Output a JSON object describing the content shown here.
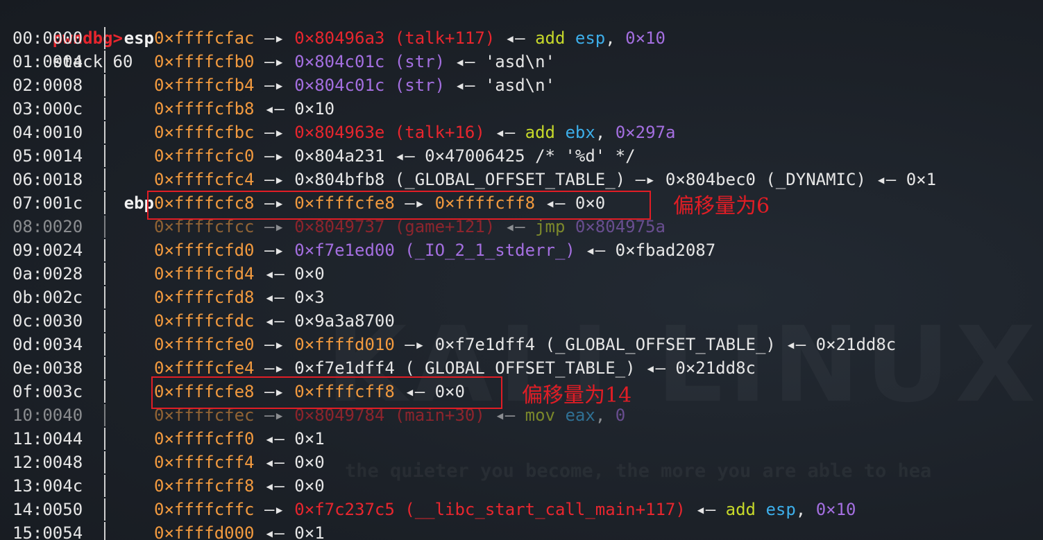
{
  "terminal": {
    "prompt": "pwndbg>",
    "command": "stack 60",
    "watermark": "KALI LINUX",
    "tagline": "the quieter you become, the more you are able to hea",
    "colors": {
      "prompt": "#e8262e",
      "stack_address": "#f29a3f",
      "code_pointer": "#e8262e",
      "data_pointer": "#a46fe0",
      "instruction": "#c6d82a",
      "register": "#3daee9",
      "annotation": "#e11d25"
    }
  },
  "stack": [
    {
      "offset": "00:0000",
      "reg": "esp",
      "parts": [
        {
          "t": "0×ffffcfac",
          "c": "addr"
        },
        {
          "t": " —▸ ",
          "c": "plain"
        },
        {
          "t": "0×80496a3 (talk+117)",
          "c": "code"
        },
        {
          "t": " ◂— ",
          "c": "plain"
        },
        {
          "t": "add",
          "c": "mnem"
        },
        {
          "t": " ",
          "c": "plain"
        },
        {
          "t": "esp",
          "c": "regname"
        },
        {
          "t": ", ",
          "c": "plain"
        },
        {
          "t": "0×10",
          "c": "imm"
        }
      ]
    },
    {
      "offset": "01:0004",
      "reg": "",
      "parts": [
        {
          "t": "0×ffffcfb0",
          "c": "addr"
        },
        {
          "t": " —▸ ",
          "c": "plain"
        },
        {
          "t": "0×804c01c (str)",
          "c": "data"
        },
        {
          "t": " ◂— ",
          "c": "plain"
        },
        {
          "t": "'asd\\n'",
          "c": "str"
        }
      ]
    },
    {
      "offset": "02:0008",
      "reg": "",
      "parts": [
        {
          "t": "0×ffffcfb4",
          "c": "addr"
        },
        {
          "t": " —▸ ",
          "c": "plain"
        },
        {
          "t": "0×804c01c (str)",
          "c": "data"
        },
        {
          "t": " ◂— ",
          "c": "plain"
        },
        {
          "t": "'asd\\n'",
          "c": "str"
        }
      ]
    },
    {
      "offset": "03:000c",
      "reg": "",
      "parts": [
        {
          "t": "0×ffffcfb8",
          "c": "addr"
        },
        {
          "t": " ◂— 0×10",
          "c": "plain"
        }
      ]
    },
    {
      "offset": "04:0010",
      "reg": "",
      "parts": [
        {
          "t": "0×ffffcfbc",
          "c": "addr"
        },
        {
          "t": " —▸ ",
          "c": "plain"
        },
        {
          "t": "0×804963e (talk+16)",
          "c": "code"
        },
        {
          "t": " ◂— ",
          "c": "plain"
        },
        {
          "t": "add",
          "c": "mnem"
        },
        {
          "t": " ",
          "c": "plain"
        },
        {
          "t": "ebx",
          "c": "regname"
        },
        {
          "t": ", ",
          "c": "plain"
        },
        {
          "t": "0×297a",
          "c": "imm"
        }
      ]
    },
    {
      "offset": "05:0014",
      "reg": "",
      "parts": [
        {
          "t": "0×ffffcfc0",
          "c": "addr"
        },
        {
          "t": " —▸ 0×804a231 ◂— 0×47006425 /* '%d' */",
          "c": "plain"
        }
      ]
    },
    {
      "offset": "06:0018",
      "reg": "",
      "parts": [
        {
          "t": "0×ffffcfc4",
          "c": "addr"
        },
        {
          "t": " —▸ 0×804bfb8 (_GLOBAL_OFFSET_TABLE_) —▸ 0×804bec0 (_DYNAMIC) ◂— 0×1",
          "c": "plain"
        }
      ]
    },
    {
      "offset": "07:001c",
      "reg": "ebp",
      "parts": [
        {
          "t": "0×ffffcfc8",
          "c": "addr"
        },
        {
          "t": " —▸ ",
          "c": "plain"
        },
        {
          "t": "0×ffffcfe8",
          "c": "addr"
        },
        {
          "t": " —▸ ",
          "c": "plain"
        },
        {
          "t": "0×ffffcff8",
          "c": "addr"
        },
        {
          "t": " ◂— 0×0",
          "c": "plain"
        }
      ]
    },
    {
      "offset": "08:0020",
      "reg": "",
      "parts": [
        {
          "t": "0×ffffcfcc",
          "c": "addr"
        },
        {
          "t": " —▸ ",
          "c": "plain"
        },
        {
          "t": "0×8049737 (game+121)",
          "c": "code"
        },
        {
          "t": " ◂— ",
          "c": "plain"
        },
        {
          "t": "jmp",
          "c": "mnem"
        },
        {
          "t": " ",
          "c": "plain"
        },
        {
          "t": "0×804975a",
          "c": "imm"
        }
      ]
    },
    {
      "offset": "09:0024",
      "reg": "",
      "parts": [
        {
          "t": "0×ffffcfd0",
          "c": "addr"
        },
        {
          "t": " —▸ ",
          "c": "plain"
        },
        {
          "t": "0×f7e1ed00 (_IO_2_1_stderr_)",
          "c": "data"
        },
        {
          "t": " ◂— 0×fbad2087",
          "c": "plain"
        }
      ]
    },
    {
      "offset": "0a:0028",
      "reg": "",
      "parts": [
        {
          "t": "0×ffffcfd4",
          "c": "addr"
        },
        {
          "t": " ◂— 0×0",
          "c": "plain"
        }
      ]
    },
    {
      "offset": "0b:002c",
      "reg": "",
      "parts": [
        {
          "t": "0×ffffcfd8",
          "c": "addr"
        },
        {
          "t": " ◂— 0×3",
          "c": "plain"
        }
      ]
    },
    {
      "offset": "0c:0030",
      "reg": "",
      "parts": [
        {
          "t": "0×ffffcfdc",
          "c": "addr"
        },
        {
          "t": " ◂— 0×9a3a8700",
          "c": "plain"
        }
      ]
    },
    {
      "offset": "0d:0034",
      "reg": "",
      "parts": [
        {
          "t": "0×ffffcfe0",
          "c": "addr"
        },
        {
          "t": " —▸ ",
          "c": "plain"
        },
        {
          "t": "0×ffffd010",
          "c": "addr"
        },
        {
          "t": " —▸ 0×f7e1dff4 (_GLOBAL_OFFSET_TABLE_) ◂— 0×21dd8c",
          "c": "plain"
        }
      ]
    },
    {
      "offset": "0e:0038",
      "reg": "",
      "parts": [
        {
          "t": "0×ffffcfe4",
          "c": "addr"
        },
        {
          "t": " —▸ 0×f7e1dff4 (_GLOBAL_OFFSET_TABLE_) ◂— 0×21dd8c",
          "c": "plain"
        }
      ]
    },
    {
      "offset": "0f:003c",
      "reg": "",
      "parts": [
        {
          "t": "0×ffffcfe8",
          "c": "addr"
        },
        {
          "t": " —▸ ",
          "c": "plain"
        },
        {
          "t": "0×ffffcff8",
          "c": "addr"
        },
        {
          "t": " ◂— 0×0",
          "c": "plain"
        }
      ]
    },
    {
      "offset": "10:0040",
      "reg": "",
      "parts": [
        {
          "t": "0×ffffcfec",
          "c": "addr"
        },
        {
          "t": " —▸ ",
          "c": "plain"
        },
        {
          "t": "0×8049784 (main+30)",
          "c": "code"
        },
        {
          "t": " ◂— ",
          "c": "plain"
        },
        {
          "t": "mov",
          "c": "mnem"
        },
        {
          "t": " ",
          "c": "plain"
        },
        {
          "t": "eax",
          "c": "regname"
        },
        {
          "t": ", ",
          "c": "plain"
        },
        {
          "t": "0",
          "c": "imm"
        }
      ]
    },
    {
      "offset": "11:0044",
      "reg": "",
      "parts": [
        {
          "t": "0×ffffcff0",
          "c": "addr"
        },
        {
          "t": " ◂— 0×1",
          "c": "plain"
        }
      ]
    },
    {
      "offset": "12:0048",
      "reg": "",
      "parts": [
        {
          "t": "0×ffffcff4",
          "c": "addr"
        },
        {
          "t": " ◂— 0×0",
          "c": "plain"
        }
      ]
    },
    {
      "offset": "13:004c",
      "reg": "",
      "parts": [
        {
          "t": "0×ffffcff8",
          "c": "addr"
        },
        {
          "t": " ◂— 0×0",
          "c": "plain"
        }
      ]
    },
    {
      "offset": "14:0050",
      "reg": "",
      "parts": [
        {
          "t": "0×ffffcffc",
          "c": "addr"
        },
        {
          "t": " —▸ ",
          "c": "plain"
        },
        {
          "t": "0×f7c237c5 (__libc_start_call_main+117)",
          "c": "code"
        },
        {
          "t": " ◂— ",
          "c": "plain"
        },
        {
          "t": "add",
          "c": "mnem"
        },
        {
          "t": " ",
          "c": "plain"
        },
        {
          "t": "esp",
          "c": "regname"
        },
        {
          "t": ", ",
          "c": "plain"
        },
        {
          "t": "0×10",
          "c": "imm"
        }
      ]
    },
    {
      "offset": "15:0054",
      "reg": "",
      "parts": [
        {
          "t": "0×ffffd000",
          "c": "addr"
        },
        {
          "t": " ◂— 0×1",
          "c": "plain"
        }
      ]
    }
  ],
  "annotations": {
    "note_offset_6": "偏移量为6",
    "note_offset_14": "偏移量为14"
  }
}
